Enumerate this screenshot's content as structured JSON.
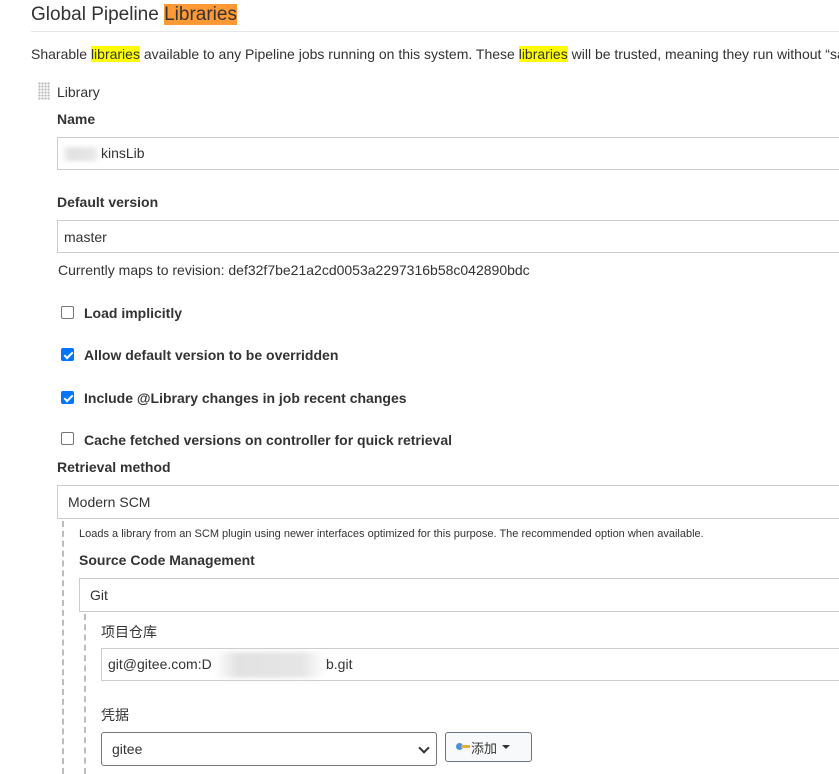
{
  "header": {
    "title_prefix": "Global Pipeline ",
    "title_highlight": "Libraries"
  },
  "description": {
    "part1": "Sharable ",
    "hl1": "libraries",
    "part2": " available to any Pipeline jobs running on this system. These ",
    "hl2": "libraries",
    "part3": " will be trusted, meaning they run without “sa"
  },
  "library": {
    "header_label": "Library",
    "name_label": "Name",
    "name_value": "kinsLib",
    "default_version_label": "Default version",
    "default_version_value": "master",
    "revision_text": "Currently maps to revision: def32f7be21a2cd0053a2297316b58c042890bdc",
    "options": [
      {
        "label": "Load implicitly",
        "checked": false
      },
      {
        "label": "Allow default version to be overridden",
        "checked": true
      },
      {
        "label": "Include @Library changes in job recent changes",
        "checked": true
      },
      {
        "label": "Cache fetched versions on controller for quick retrieval",
        "checked": false
      }
    ],
    "retrieval_method_label": "Retrieval method",
    "retrieval_method_value": "Modern SCM",
    "retrieval_note": "Loads a library from an SCM plugin using newer interfaces optimized for this purpose. The recommended option when available.",
    "scm_label": "Source Code Management",
    "scm_value": "Git",
    "repo_label": "项目仓库",
    "repo_value_prefix": "git@gitee.com:D",
    "repo_value_suffix": "b.git",
    "credentials_label": "凭据",
    "credentials_value": "gitee",
    "add_button_label": "添加"
  },
  "colors": {
    "highlight_yellow": "#ffff00",
    "highlight_orange": "#ff9933",
    "checkbox_accent": "#0075ff"
  },
  "icons": [
    "drag-handle-icon",
    "key-icon",
    "chevron-down-icon",
    "caret-down-icon"
  ]
}
